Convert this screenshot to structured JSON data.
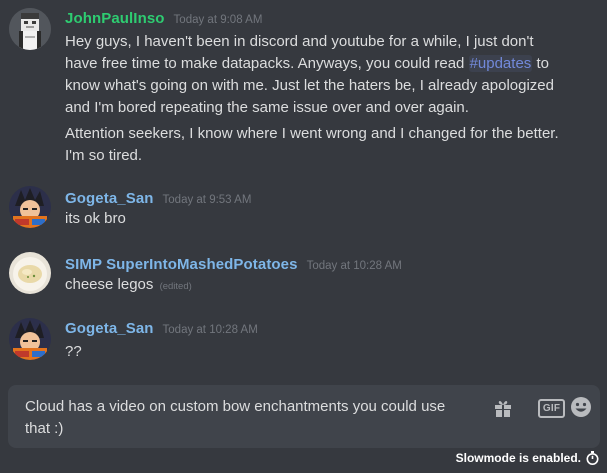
{
  "messages": [
    {
      "author": "JohnPaulInso",
      "author_color": "#2ecc71",
      "timestamp": "Today at 9:08 AM",
      "paragraphs": [
        {
          "before": "Hey guys, I haven't been in discord and youtube for a while, I just don't have free time to make datapacks. Anyways, you could read ",
          "mention": "#updates",
          "after": " to know what's going on with me. Just let the haters be, I already apologized and I'm bored repeating the same issue over and over again."
        },
        {
          "text": "Attention seekers, I know where I went wrong and I changed for the better. I'm so tired."
        }
      ]
    },
    {
      "author": "Gogeta_San",
      "author_color": "#7eb6e8",
      "timestamp": "Today at 9:53 AM",
      "text": "its ok bro"
    },
    {
      "author": "SIMP SuperIntoMashedPotatoes",
      "author_color": "#7eb6e8",
      "timestamp": "Today at 10:28 AM",
      "text": "cheese legos",
      "edited": "(edited)"
    },
    {
      "author": "Gogeta_San",
      "author_color": "#7eb6e8",
      "timestamp": "Today at 10:28 AM",
      "text": "??"
    }
  ],
  "composer": {
    "value": "Cloud has a video on custom bow enchantments you could use that :)",
    "gift_icon": "gift-icon",
    "gif_label": "GIF",
    "emoji_icon": "emoji-icon"
  },
  "footer": {
    "slowmode_text": "Slowmode is enabled.",
    "icon": "stopwatch-icon"
  }
}
